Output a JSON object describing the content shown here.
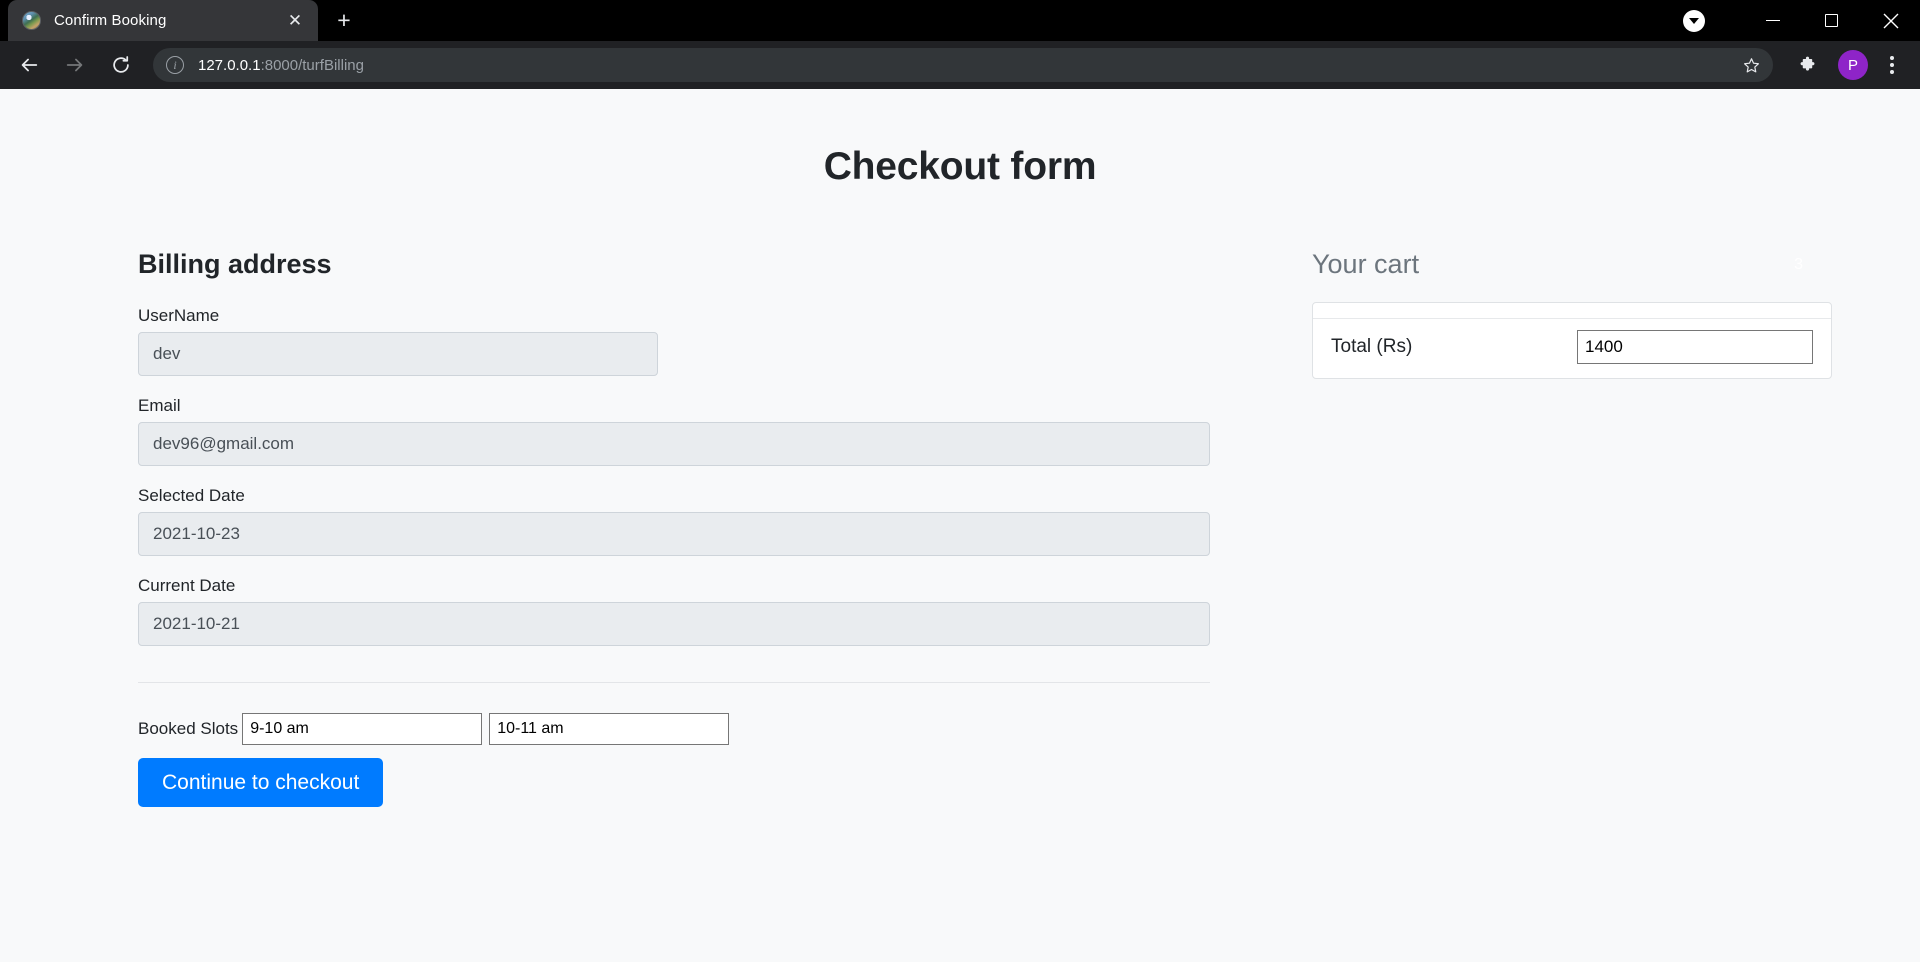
{
  "browser": {
    "tab": {
      "title": "Confirm Booking",
      "favicon": "globe-favicon",
      "close_label": "✕"
    },
    "new_tab_label": "+",
    "window_controls": {
      "minimize_label": "",
      "maximize_label": "",
      "close_label": ""
    },
    "toolbar": {
      "back_label": "",
      "forward_label": "",
      "reload_label": "",
      "url_host": "127.0.0.1",
      "url_rest": ":8000/turfBilling",
      "url_full": "127.0.0.1:8000/turfBilling",
      "info_glyph": "i",
      "bookmark_label": "",
      "extensions_label": "",
      "profile_initial": "P",
      "menu_label": ""
    }
  },
  "page": {
    "title": "Checkout form",
    "billing": {
      "heading": "Billing address",
      "fields": [
        {
          "label": "UserName",
          "value": "dev",
          "name": "username"
        },
        {
          "label": "Email",
          "value": "dev96@gmail.com",
          "name": "email"
        },
        {
          "label": "Selected Date",
          "value": "2021-10-23",
          "name": "selected-date"
        },
        {
          "label": "Current Date",
          "value": "2021-10-21",
          "name": "current-date"
        }
      ],
      "slots_label": "Booked Slots",
      "slots": [
        {
          "value": "9-10 am"
        },
        {
          "value": "10-11 am"
        }
      ],
      "submit_label": "Continue to checkout"
    },
    "cart": {
      "heading": "Your cart",
      "badge": "3",
      "total_label": "Total (Rs)",
      "total_value": "1400"
    }
  },
  "colors": {
    "primary": "#007bff",
    "page_bg": "#f8f9fa",
    "input_bg": "#e9ecef",
    "muted": "#6c757d",
    "chrome_titlebar": "#000000",
    "chrome_toolbar": "#202124",
    "tab_active": "#353639",
    "profile_avatar": "#8e24c8"
  }
}
